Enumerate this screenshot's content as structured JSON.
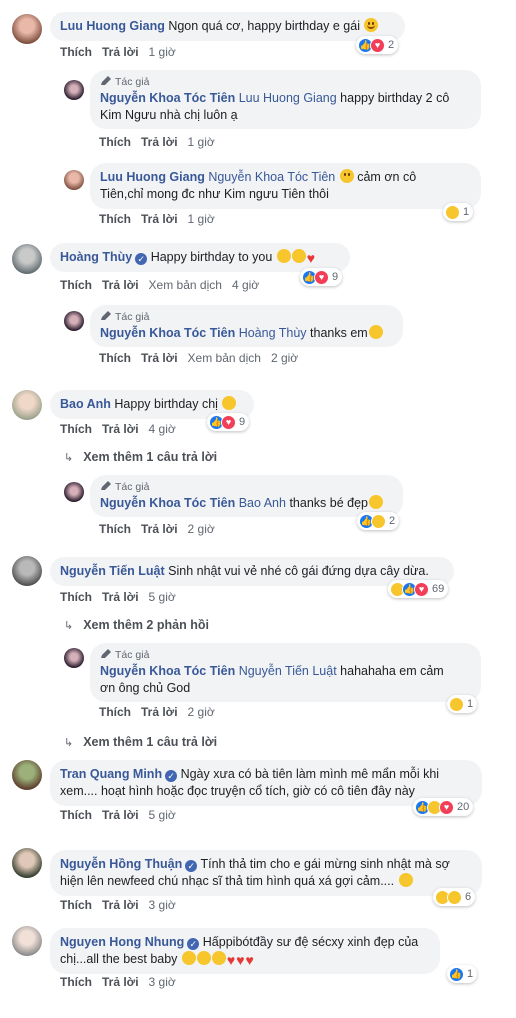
{
  "common": {
    "like": "Thích",
    "reply": "Trả lời",
    "translate": "Xem bản dịch",
    "author_badge": "Tác giả"
  },
  "c1": {
    "name": "Luu Huong Giang",
    "text": "Ngon quá cơ, happy birthday e gái",
    "time": "1 giờ",
    "reactions": "2"
  },
  "r1": {
    "name": "Nguyễn Khoa Tóc Tiên",
    "mention": "Luu Huong Giang",
    "text_1": "happy birthday 2 cô",
    "text_2": "Kim Ngưu nhà chị luôn ạ",
    "time": "1 giờ"
  },
  "r2": {
    "name": "Luu Huong Giang",
    "mention": "Nguyễn Khoa Tóc Tiên",
    "text_1": "cảm ơn cô",
    "text_2": "Tiên,chỉ mong đc như Kim ngưu Tiên thôi",
    "time": "1 giờ",
    "reactions": "1"
  },
  "c2": {
    "name": "Hoàng Thùy",
    "text": "Happy birthday to you",
    "time": "4 giờ",
    "reactions": "9"
  },
  "r3": {
    "name": "Nguyễn Khoa Tóc Tiên",
    "mention": "Hoàng Thùy",
    "text": "thanks em",
    "time": "2 giờ"
  },
  "c3": {
    "name": "Bao Anh",
    "text": "Happy birthday chị",
    "time": "4 giờ",
    "reactions": "9",
    "more": "Xem thêm 1 câu trả lời"
  },
  "r4": {
    "name": "Nguyễn Khoa Tóc Tiên",
    "mention": "Bao Anh",
    "text": "thanks bé đẹp",
    "time": "2 giờ",
    "reactions": "2"
  },
  "c4": {
    "name": "Nguyễn Tiến Luật",
    "text": "Sinh nhật vui vẻ nhé cô gái đứng dựa cây dừa.",
    "time": "5 giờ",
    "reactions": "69",
    "more": "Xem thêm 2 phản hồi"
  },
  "r5": {
    "name": "Nguyễn Khoa Tóc Tiên",
    "mention": "Nguyễn Tiến Luật",
    "text_1": "hahahaha em cảm",
    "text_2": "ơn ông chủ God",
    "time": "2 giờ",
    "reactions": "1",
    "more": "Xem thêm 1 câu trả lời"
  },
  "c5": {
    "name": "Tran Quang Minh",
    "text_1": "Ngày xưa có bà tiên làm mình mê mẩn mỗi khi",
    "text_2": "xem.... hoạt hình hoặc đọc truyện cổ tích, giờ có cô tiên đây này",
    "time": "5 giờ",
    "reactions": "20"
  },
  "c6": {
    "name": "Nguyễn Hồng Thuận",
    "text_1": "Tính thả tim cho e gái mừng sinh nhật mà sợ",
    "text_2": "hiện lên newfeed chú nhạc sĩ thả tim hình quá xá gợi cảm....",
    "time": "3 giờ",
    "reactions": "6"
  },
  "c7": {
    "name": "Nguyen Hong Nhung",
    "text_1": "Hấppibótđầy sư đệ sécxy xinh đẹp của",
    "text_2": "chị...all the best baby",
    "time": "3 giờ",
    "reactions": "1"
  },
  "colors": {
    "name": "#385898",
    "bubble": "#f2f3f5",
    "meta": "#606770",
    "like": "#1877f2",
    "love": "#f33e58",
    "haha": "#f7c52c"
  }
}
